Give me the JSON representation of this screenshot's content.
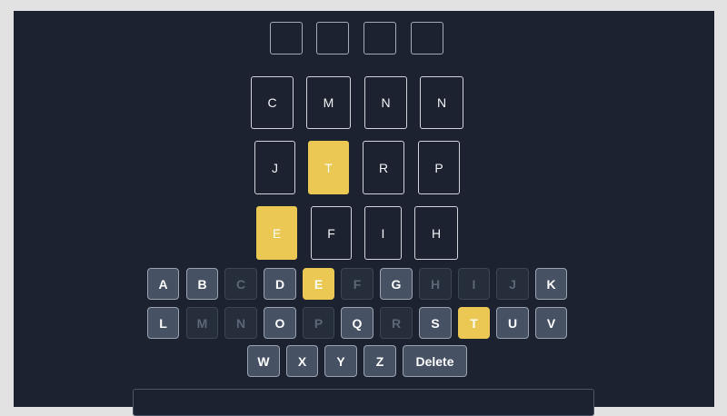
{
  "grid_rows": [
    [
      "C",
      "M",
      "N",
      "N"
    ],
    [
      "J",
      "T",
      "R",
      "P"
    ],
    [
      "E",
      "F",
      "I",
      "H"
    ]
  ],
  "keyboard": {
    "row1": [
      "A",
      "B",
      "C",
      "D",
      "E",
      "F",
      "G",
      "H",
      "I",
      "J",
      "K"
    ],
    "row2": [
      "L",
      "M",
      "N",
      "O",
      "P",
      "Q",
      "R",
      "S",
      "T",
      "U",
      "V"
    ],
    "row3": [
      "W",
      "X",
      "Y",
      "Z"
    ],
    "delete_label": "Delete"
  },
  "colors": {
    "background": "#1c2230",
    "highlight": "#ebc853",
    "key": "#465163",
    "used_key": "#262d3b"
  }
}
